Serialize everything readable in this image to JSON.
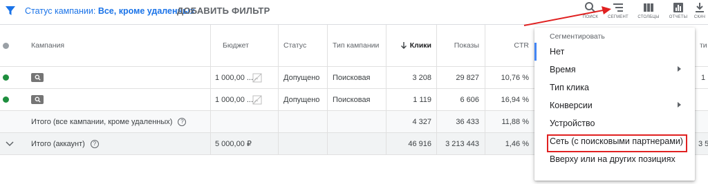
{
  "filter_bar": {
    "status_prefix": "Статус кампании:",
    "status_value": "Все, кроме удаленных",
    "add_filter": "ДОБАВИТЬ ФИЛЬТР"
  },
  "toolbar": {
    "search_label": "ПОИСК",
    "segment_label": "СЕГМЕНТ",
    "columns_label": "СТОЛБЦЫ",
    "reports_label": "ОТЧЕТЫ",
    "download_label": "СКАЧ"
  },
  "table": {
    "headers": {
      "campaign": "Кампания",
      "budget": "Бюджет",
      "status": "Статус",
      "type": "Тип кампании",
      "clicks": "Клики",
      "impressions": "Показы",
      "ctr": "CTR",
      "extra": "ти"
    },
    "rows": [
      {
        "budget": "1 000,00 ...",
        "status": "Допущено",
        "type": "Поисковая",
        "clicks": "3 208",
        "impressions": "29 827",
        "ctr": "10,76 %",
        "extra": "1"
      },
      {
        "budget": "1 000,00 ...",
        "status": "Допущено",
        "type": "Поисковая",
        "clicks": "1 119",
        "impressions": "6 606",
        "ctr": "16,94 %",
        "extra": ""
      }
    ],
    "subtotal": {
      "label": "Итого (все кампании, кроме удаленных)",
      "clicks": "4 327",
      "impressions": "36 433",
      "ctr": "11,88 %",
      "extra": ""
    },
    "account_total": {
      "label": "Итого (аккаунт)",
      "budget": "5 000,00 ₽",
      "clicks": "46 916",
      "impressions": "3 213 443",
      "ctr": "1,46 %",
      "extra": "3 5"
    }
  },
  "segment_menu": {
    "title": "Сегментировать",
    "items": [
      {
        "label": "Нет",
        "has_submenu": false
      },
      {
        "label": "Время",
        "has_submenu": true
      },
      {
        "label": "Тип клика",
        "has_submenu": false
      },
      {
        "label": "Конверсии",
        "has_submenu": true
      },
      {
        "label": "Устройство",
        "has_submenu": false
      },
      {
        "label": "Сеть (с поисковыми партнерами)",
        "has_submenu": false
      },
      {
        "label": "Вверху или на других позициях",
        "has_submenu": false
      }
    ]
  },
  "colors": {
    "accent": "#1a73e8",
    "status_green": "#1e8e3e",
    "annotation_red": "#e02020"
  },
  "icons": [
    "filter-icon",
    "search-icon",
    "segment-icon",
    "columns-icon",
    "reports-icon",
    "download-icon",
    "sort-arrow-down-icon",
    "help-icon",
    "chevron-down-icon",
    "chevron-right-icon",
    "image-placeholder-icon",
    "search-network-icon"
  ]
}
